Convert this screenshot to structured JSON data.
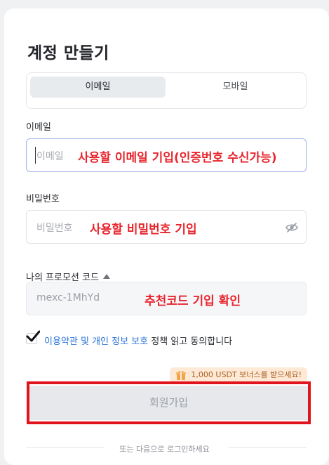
{
  "title": "계정 만들기",
  "tabs": [
    {
      "label": "이메일",
      "active": true
    },
    {
      "label": "모바일",
      "active": false
    }
  ],
  "email": {
    "label": "이메일",
    "placeholder": "이메일",
    "annotation": "사용할 이메일 기입(인증번호 수신가능)"
  },
  "password": {
    "label": "비밀번호",
    "placeholder": "비밀번호",
    "annotation": "사용할 비밀번호 기입",
    "visibility_icon": "eye-off-icon"
  },
  "promo": {
    "label": "나의 프로모션 코드",
    "value": "mexc-1MhYd",
    "annotation": "추천코드 기입 확인"
  },
  "agreement": {
    "checked": true,
    "terms_link": "이용약관",
    "and_text": " 및 ",
    "privacy_link": "개인 정보 보호",
    "suffix": " 정책 읽고 동의합니다"
  },
  "bonus": {
    "text": "1,000 USDT 보너스를 받으세요!",
    "icon": "gift-icon"
  },
  "submit_label": "회원가입",
  "divider_text": "또는 다음으로 로그인하세요",
  "colors": {
    "link": "#2a73d9",
    "annotation": "#e8242d",
    "highlight_box": "#e0141d",
    "bonus_bg": "#fde9d6",
    "bonus_text": "#a85e1f"
  }
}
